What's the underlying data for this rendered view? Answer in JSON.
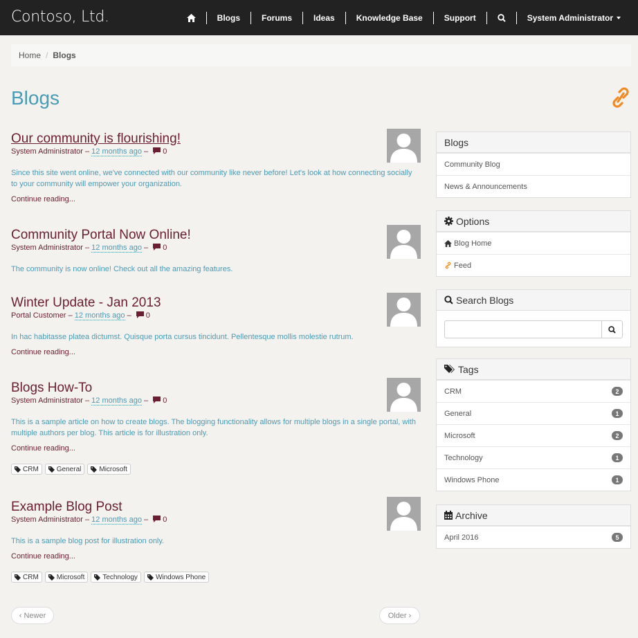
{
  "navbar": {
    "brand": "Contoso, Ltd.",
    "items": [
      "Blogs",
      "Forums",
      "Ideas",
      "Knowledge Base",
      "Support"
    ],
    "user": "System Administrator"
  },
  "breadcrumb": {
    "home": "Home",
    "current": "Blogs"
  },
  "page": {
    "title": "Blogs"
  },
  "posts": [
    {
      "title": "Our community is flourishing!",
      "author": "System Administrator",
      "sep": "–",
      "time": "12 months ago",
      "comments": "0",
      "summary": "Since this site went online, we've connected with our community like never before! Let's look at how connecting socially to your community will empower your organization.",
      "continue": "Continue reading..."
    },
    {
      "title": "Community Portal Now Online!",
      "author": "System Administrator",
      "sep": "–",
      "time": "12 months ago",
      "comments": "0",
      "summary": "The community is now online! Check out all the amazing features."
    },
    {
      "title": "Winter Update - Jan 2013",
      "author": "Portal Customer",
      "sep": "–",
      "time": "12 months ago",
      "comments": "0",
      "summary": "In hac habitasse platea dictumst. Quisque porta cursus tincidunt. Pellentesque mollis molestie rutrum.",
      "continue": "Continue reading..."
    },
    {
      "title": "Blogs How-To",
      "author": "System Administrator",
      "sep": "–",
      "time": "12 months ago",
      "comments": "0",
      "summary": "This is a sample article on how to create blogs. The blogging functionality allows for multiple blogs in a single portal, with multiple authors per blog. This article is for illustration only.",
      "continue": "Continue reading...",
      "tags": [
        "CRM",
        "General",
        "Microsoft"
      ]
    },
    {
      "title": "Example Blog Post",
      "author": "System Administrator",
      "sep": "–",
      "time": "12 months ago",
      "comments": "0",
      "summary": "This is a sample blog post for illustration only.",
      "continue": "Continue reading...",
      "tags": [
        "CRM",
        "Microsoft",
        "Technology",
        "Windows Phone"
      ]
    }
  ],
  "pager": {
    "newer": "‹ Newer",
    "older": "Older ›"
  },
  "sidebar": {
    "blogs": {
      "heading": "Blogs",
      "items": [
        "Community Blog",
        "News & Announcements"
      ]
    },
    "options": {
      "heading": "Options",
      "items": [
        "Blog Home",
        "Feed"
      ]
    },
    "search": {
      "heading": "Search Blogs",
      "placeholder": ""
    },
    "tags": {
      "heading": "Tags",
      "items": [
        {
          "label": "CRM",
          "count": "2"
        },
        {
          "label": "General",
          "count": "1"
        },
        {
          "label": "Microsoft",
          "count": "2"
        },
        {
          "label": "Technology",
          "count": "1"
        },
        {
          "label": "Windows Phone",
          "count": "1"
        }
      ]
    },
    "archive": {
      "heading": "Archive",
      "items": [
        {
          "label": "April 2016",
          "count": "5"
        }
      ]
    }
  },
  "colors": {
    "accent": "#4a9bb5",
    "link": "#6b1e31",
    "navbar": "#222222",
    "feed": "#f08a24"
  }
}
